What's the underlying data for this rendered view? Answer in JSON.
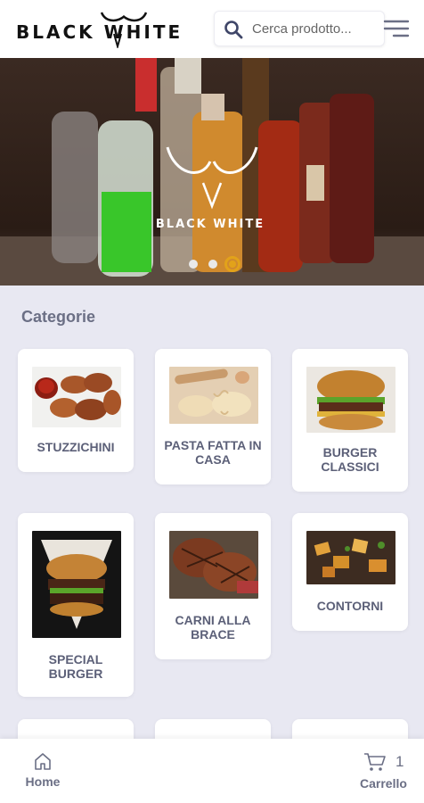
{
  "header": {
    "logo_text": "BLACK WHITE",
    "search": {
      "placeholder": "Cerca prodotto..."
    }
  },
  "hero": {
    "watermark_text": "BLACK WHITE",
    "slides_count": 3,
    "active_slide": 3
  },
  "categories": {
    "title": "Categorie",
    "items": [
      {
        "label": "STUZZICHINI"
      },
      {
        "label": "PASTA FATTA IN CASA"
      },
      {
        "label": "BURGER CLASSICI"
      },
      {
        "label": "SPECIAL BURGER"
      },
      {
        "label": "CARNI ALLA BRACE"
      },
      {
        "label": "CONTORNI"
      }
    ]
  },
  "bottom_nav": {
    "home_label": "Home",
    "cart_label": "Carrello",
    "cart_count": "1"
  },
  "colors": {
    "accent": "#e2a21a",
    "text_muted": "#6b6f85",
    "background": "#e8e8f2"
  }
}
